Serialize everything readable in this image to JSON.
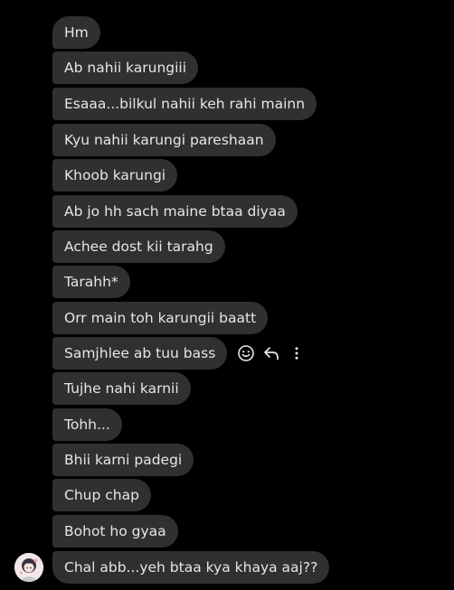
{
  "conversation": {
    "messages": [
      {
        "text": "Hm"
      },
      {
        "text": "Ab nahii karungiii"
      },
      {
        "text": "Esaaa...bilkul nahii keh rahi mainn"
      },
      {
        "text": "Kyu nahii karungi pareshaan"
      },
      {
        "text": "Khoob karungi"
      },
      {
        "text": "Ab jo hh sach maine btaa diyaa"
      },
      {
        "text": "Achee dost kii tarahg"
      },
      {
        "text": "Tarahh*"
      },
      {
        "text": "Orr main toh karungii baatt"
      },
      {
        "text": "Samjhlee ab tuu bass"
      },
      {
        "text": "Tujhe nahi karnii"
      },
      {
        "text": "Tohh..."
      },
      {
        "text": "Bhii karni padegi"
      },
      {
        "text": "Chup chap"
      },
      {
        "text": "Bohot ho gyaa"
      },
      {
        "text": "Chal abb...yeh btaa kya khaya aaj??"
      }
    ],
    "hover_actions": [
      "react-icon",
      "reply-icon",
      "more-options-icon"
    ],
    "sender_avatar": "sender-avatar"
  },
  "colors": {
    "background": "#000000",
    "bubble": "#303030",
    "text": "#e4e6eb",
    "icon": "#e4e6eb"
  }
}
